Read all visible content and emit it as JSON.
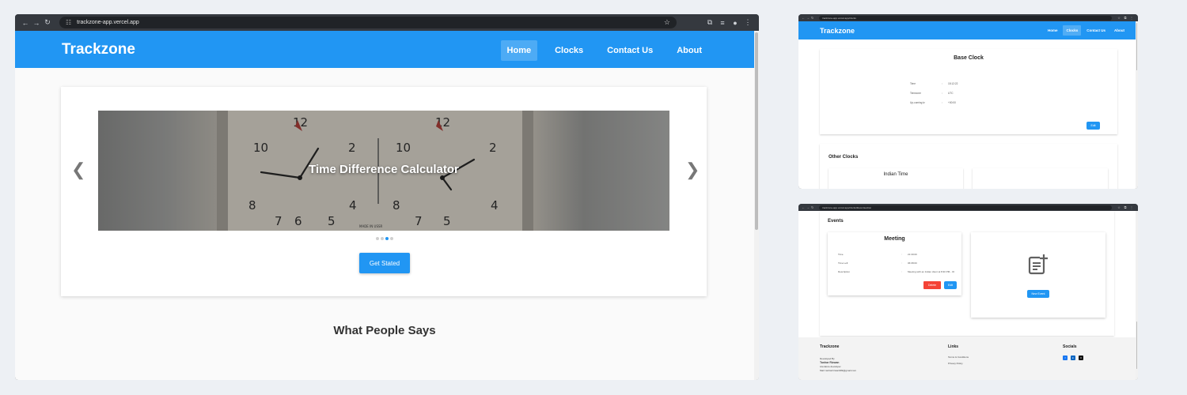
{
  "main_window": {
    "url": "trackzone-app.vercel.app",
    "site": {
      "brand": "Trackzone",
      "nav": [
        "Home",
        "Clocks",
        "Contact Us",
        "About"
      ],
      "active_nav": "Home"
    },
    "carousel": {
      "caption": "Time Difference Calculator",
      "slide_count": 4,
      "active_slide": 3,
      "cta_label": "Get Stated"
    },
    "section_title": "What People Says"
  },
  "clocks_window": {
    "url": "trackzone-app.vercel.app/clocks",
    "site": {
      "brand": "Trackzone",
      "nav": [
        "Home",
        "Clocks",
        "Contact Us",
        "About"
      ],
      "active_nav": "Clocks"
    },
    "base_clock": {
      "title": "Base Clock",
      "rows": [
        {
          "label": "Time",
          "sep": ":",
          "value": "15:12:22"
        },
        {
          "label": "Timezone",
          "sep": ":",
          "value": "UTC"
        },
        {
          "label": "Up-coming tz",
          "sep": ":",
          "value": "+00:00"
        }
      ],
      "edit_label": "Edit"
    },
    "other_clocks": {
      "title": "Other Clocks",
      "cards": [
        "Indian Time"
      ]
    }
  },
  "events_window": {
    "url": "trackzone-app.vercel.app/clocks/#eventsection",
    "events": {
      "title": "Events",
      "card": {
        "name": "Meeting",
        "rows": [
          {
            "label": "Time",
            "sep": ":",
            "value": "21:30:00"
          },
          {
            "label": "Time Left",
            "sep": ":",
            "value": "06:08:00"
          },
          {
            "label": "Description",
            "sep": ":",
            "value": "Meeting with an Indian client at 8:30 PM - IO"
          }
        ],
        "delete_label": "Delete",
        "edit_label": "Edit"
      },
      "new_event_label": "New Event"
    },
    "footer": {
      "brand": "Trackzone",
      "developed_by_label": "Developed By",
      "developer_name": "Tanhar Rizwan",
      "developer_role": "Literature developer",
      "email": "Mail: tanharrizwan999@gmail.com",
      "links_title": "Links",
      "links": [
        "Terms & Conditions",
        "Privacy Policy"
      ],
      "socials_title": "Socials"
    }
  },
  "colors": {
    "brand_blue": "#2196f3",
    "danger_red": "#f44336",
    "page_bg": "#edf0f4",
    "browser_frame": "#35393f"
  }
}
